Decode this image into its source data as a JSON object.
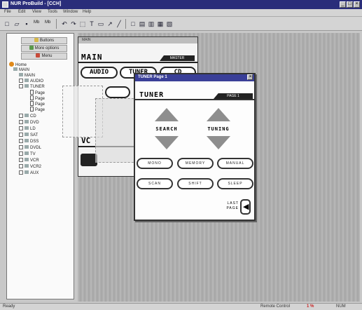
{
  "app": {
    "title": "NUR ProBuild - [CCH]",
    "window_controls": {
      "minimize": "_",
      "maximize": "□",
      "close": "×"
    }
  },
  "menubar": {
    "items": [
      "File",
      "Edit",
      "View",
      "Tools",
      "Window",
      "Help"
    ]
  },
  "toolbar": {
    "buttons": [
      {
        "icon": "new-icon",
        "glyph": "□"
      },
      {
        "icon": "open-icon",
        "glyph": "▱"
      },
      {
        "icon": "save-icon",
        "glyph": "▪"
      }
    ],
    "text1": "Mb",
    "text2": "Mb",
    "tools": [
      "↶",
      "↷",
      "⬚",
      "T",
      "▭",
      "↗",
      "╱",
      "□",
      "▤",
      "▥",
      "▦",
      "▧"
    ]
  },
  "tree": {
    "headers": [
      {
        "label": "Buttons",
        "color": "#d6b84a"
      },
      {
        "label": "More options",
        "color": "#5a9a4a"
      },
      {
        "label": "Menu",
        "color": "#c84a3a"
      }
    ],
    "items": [
      {
        "label": "Home",
        "kind": "home",
        "indent": 0
      },
      {
        "label": "MAIN",
        "kind": "group",
        "indent": 1
      },
      {
        "label": "MAIN",
        "kind": "box",
        "indent": 2
      },
      {
        "label": "AUDIO",
        "kind": "box",
        "indent": 2
      },
      {
        "label": "TUNER",
        "kind": "box",
        "indent": 2
      },
      {
        "label": "Page",
        "kind": "page",
        "indent": 4
      },
      {
        "label": "Page",
        "kind": "page",
        "indent": 4
      },
      {
        "label": "Page",
        "kind": "page",
        "indent": 4
      },
      {
        "label": "Page",
        "kind": "page",
        "indent": 4
      },
      {
        "label": "CD",
        "kind": "box",
        "indent": 2
      },
      {
        "label": "DVD",
        "kind": "box",
        "indent": 2
      },
      {
        "label": "LD",
        "kind": "box",
        "indent": 2
      },
      {
        "label": "SAT",
        "kind": "box",
        "indent": 2
      },
      {
        "label": "DSS",
        "kind": "box",
        "indent": 2
      },
      {
        "label": "DVDL",
        "kind": "box",
        "indent": 2
      },
      {
        "label": "TV",
        "kind": "box",
        "indent": 2
      },
      {
        "label": "VCR",
        "kind": "box",
        "indent": 2
      },
      {
        "label": "VCR2",
        "kind": "box",
        "indent": 2
      },
      {
        "label": "AUX",
        "kind": "box",
        "indent": 2
      }
    ]
  },
  "main_window": {
    "title": "MAIN",
    "label": "MAIN",
    "tag": "MASTER",
    "buttons": [
      "AUDIO",
      "TUNER",
      "CD"
    ],
    "vc_label": "VC"
  },
  "tuner_window": {
    "title": "TUNER Page 1",
    "label": "TUNER",
    "tag": "PAGE 1",
    "search_label": "SEARCH",
    "tuning_label": "TUNING",
    "row1": [
      "MONO",
      "MEMORY",
      "MANUAL"
    ],
    "row2": [
      "SCAN",
      "SHIFT",
      "SLEEP"
    ],
    "last_label_1": "LAST",
    "last_label_2": "PAGE",
    "back_glyph": "◀"
  },
  "statusbar": {
    "left": "Ready",
    "right": "Remote Control",
    "right_value": "1 %",
    "right_extra": "NUM"
  }
}
